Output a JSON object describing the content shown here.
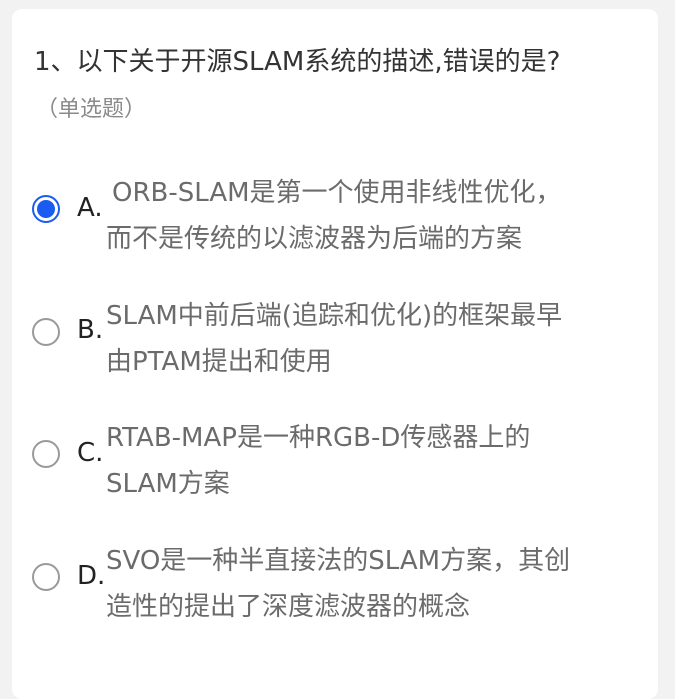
{
  "question": {
    "title": "1、以下关于开源SLAM系统的描述,错误的是?",
    "type_label": "（单选题）"
  },
  "options": [
    {
      "letter": "A.",
      "line1": "ORB-SLAM是第一个使用非线性优化，",
      "line2": "而不是传统的以滤波器为后端的方案",
      "selected": true
    },
    {
      "letter": "B.",
      "line1": "SLAM中前后端(追踪和优化)的框架最早",
      "line2": "由PTAM提出和使用",
      "selected": false
    },
    {
      "letter": "C.",
      "line1": "RTAB-MAP是一种RGB-D传感器上的",
      "line2": "SLAM方案",
      "selected": false
    },
    {
      "letter": "D.",
      "line1": "SVO是一种半直接法的SLAM方案，其创",
      "line2": "造性的提出了深度滤波器的概念",
      "selected": false
    }
  ],
  "colors": {
    "selected_accent": "#1a5cf0",
    "option_text": "#6b6b6b"
  }
}
